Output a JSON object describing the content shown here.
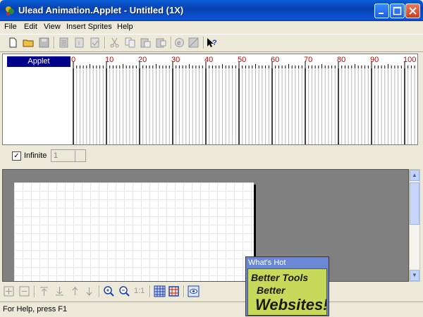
{
  "window": {
    "title": "Ulead Animation.Applet - Untitled (1X)"
  },
  "menu": [
    {
      "label": "File"
    },
    {
      "label": "Edit"
    },
    {
      "label": "View"
    },
    {
      "label": "Insert Sprites"
    },
    {
      "label": "Help"
    }
  ],
  "toolbar": {
    "icons": [
      "new-file-icon",
      "open-folder-icon",
      "save-icon",
      "export-icon",
      "properties-icon",
      "settings-icon",
      "cut-icon",
      "copy-icon",
      "paste-icon",
      "paste-special-icon",
      "preview-browser-icon",
      "export-image-icon",
      "help-pointer-icon"
    ]
  },
  "timeline": {
    "track_label": "Applet",
    "ruler_labels": [
      "0",
      "10",
      "20",
      "30",
      "40",
      "50",
      "60",
      "70",
      "80",
      "90",
      "100"
    ],
    "infinite_label": "Infinite",
    "infinite_checked": true,
    "loop_count": "1"
  },
  "bottom_toolbar": {
    "icons": [
      "align-center-icon",
      "align-middle-icon",
      "bring-to-front-icon",
      "send-to-back-icon",
      "move-up-icon",
      "move-down-icon",
      "zoom-in-icon",
      "zoom-out-icon",
      "actual-size-icon",
      "grid-icon",
      "frame-icon",
      "preview-icon"
    ],
    "actual_size_label": "1:1"
  },
  "status": {
    "text": "For Help, press F1"
  },
  "whats_hot": {
    "title": "What's Hot",
    "lines": [
      "Better Tools",
      "Better",
      "Websites!"
    ]
  }
}
